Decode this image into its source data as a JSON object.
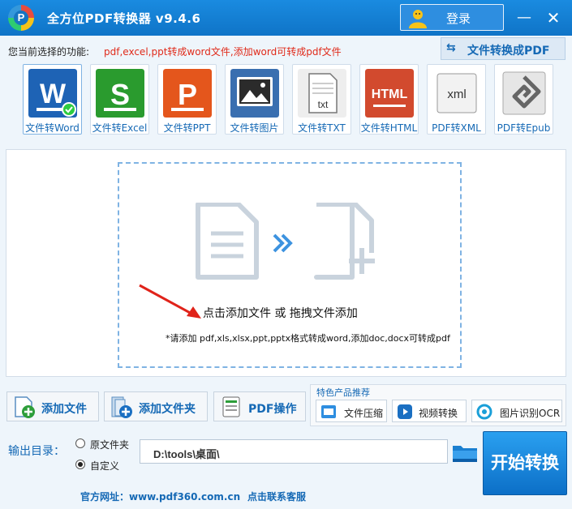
{
  "titlebar": {
    "title": "全方位PDF转换器 v9.4.6",
    "login_label": "登录",
    "minimize_glyph": "—",
    "close_glyph": "✕"
  },
  "function_bar": {
    "label": "您当前选择的功能:",
    "value": "pdf,excel,ppt转成word文件,添加word可转成pdf文件",
    "mode_button_label": "文件转换成PDF"
  },
  "tools": [
    {
      "label": "文件转Word",
      "icon": "word-icon",
      "color": "#1e63b5"
    },
    {
      "label": "文件转Excel",
      "icon": "excel-icon",
      "color": "#2a9b2e"
    },
    {
      "label": "文件转PPT",
      "icon": "ppt-icon",
      "color": "#e4561c"
    },
    {
      "label": "文件转图片",
      "icon": "image-icon",
      "color": "#3a6fb0"
    },
    {
      "label": "文件转TXT",
      "icon": "txt-icon",
      "color": "#555555"
    },
    {
      "label": "文件转HTML",
      "icon": "html-icon",
      "color": "#d24a2e"
    },
    {
      "label": "PDF转XML",
      "icon": "xml-icon",
      "color": "#555555"
    },
    {
      "label": "PDF转Epub",
      "icon": "epub-icon",
      "color": "#777777"
    }
  ],
  "drop": {
    "text": "点击添加文件 或 拖拽文件添加",
    "hint": "*请添加 pdf,xls,xlsx,ppt,pptx格式转成word,添加doc,docx可转成pdf"
  },
  "actions": {
    "add_file": "添加文件",
    "add_folder": "添加文件夹",
    "pdf_ops": "PDF操作"
  },
  "features": {
    "title": "特色产品推荐",
    "compress": "文件压缩",
    "video": "视频转换",
    "ocr": "图片识别OCR"
  },
  "output": {
    "label": "输出目录：",
    "option_original": "原文件夹",
    "option_custom": "自定义",
    "path": "D:\\tools\\桌面\\",
    "start_label": "开始转换"
  },
  "footer": {
    "site": "官方网址：www.pdf360.com.cn",
    "contact": "点击联系客服"
  },
  "colors": {
    "accent": "#1569b5",
    "titlebar": "#1a8be0",
    "function_value": "#e02a1a"
  }
}
